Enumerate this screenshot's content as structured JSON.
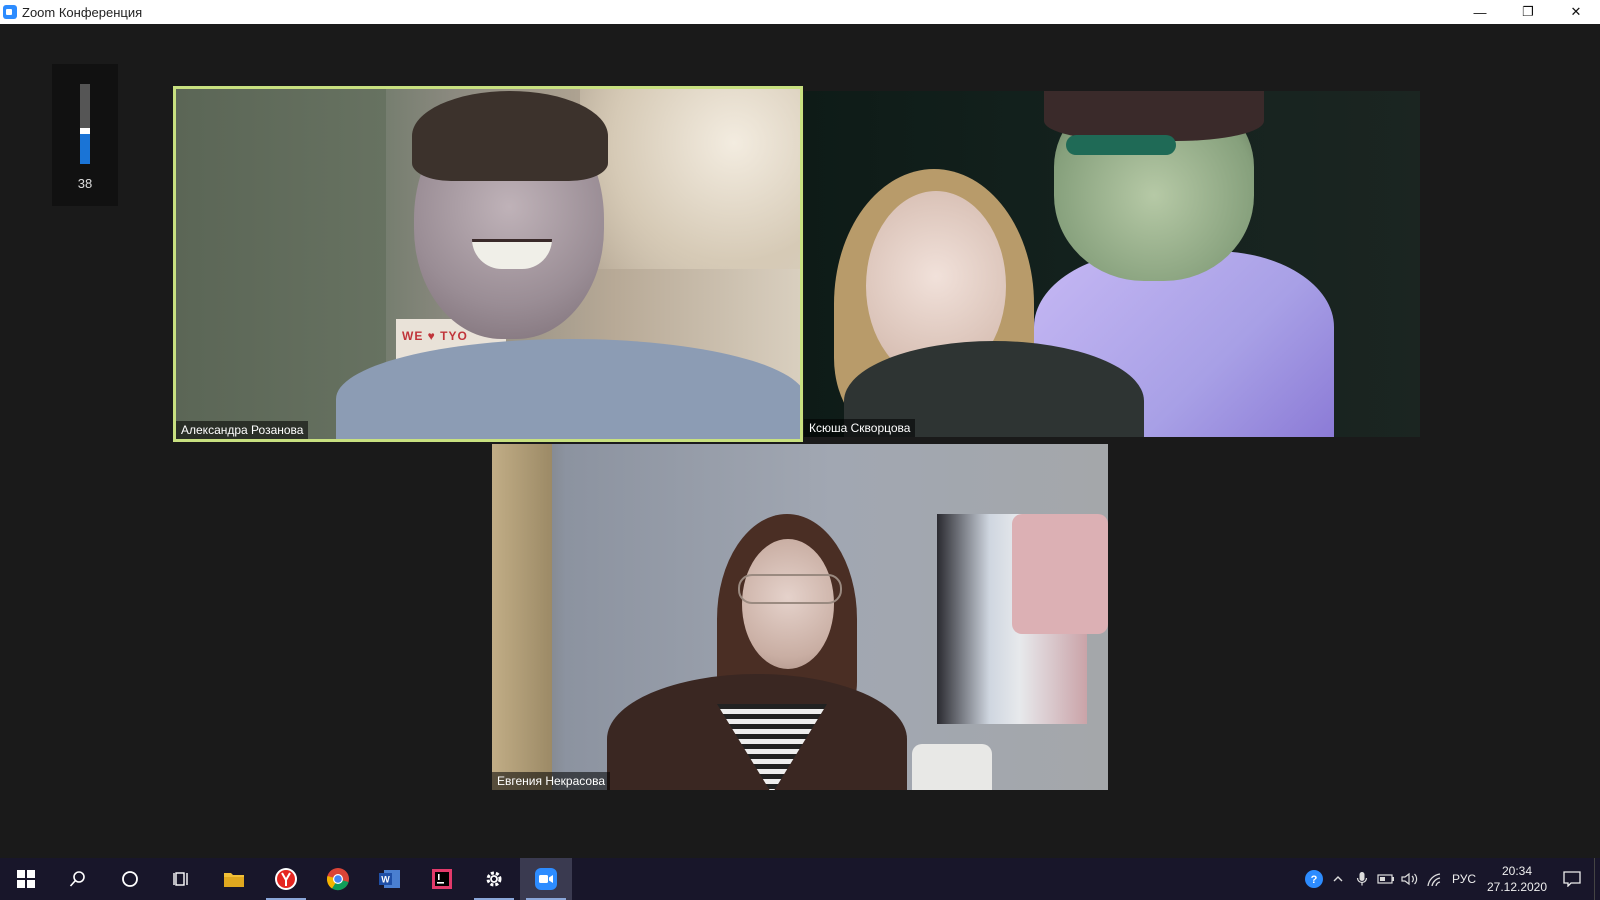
{
  "window": {
    "title": "Zoom Конференция",
    "controls": {
      "minimize": "—",
      "maximize": "❐",
      "close": "✕"
    }
  },
  "audio_meter": {
    "value": "38",
    "level": 0.38
  },
  "participants": [
    {
      "name": "Александра Розанова",
      "active_speaker": true
    },
    {
      "name": "Ксюша Скворцова",
      "active_speaker": false
    },
    {
      "name": "Евгения Некрасова",
      "active_speaker": false
    }
  ],
  "tile1_poster_text": "WE ♥ TYO",
  "taskbar": {
    "apps": [
      {
        "icon": "windows-start-icon"
      },
      {
        "icon": "search-icon"
      },
      {
        "icon": "cortana-icon"
      },
      {
        "icon": "task-view-icon"
      },
      {
        "icon": "file-explorer-icon"
      },
      {
        "icon": "yandex-browser-icon",
        "active": true
      },
      {
        "icon": "chrome-icon"
      },
      {
        "icon": "word-icon"
      },
      {
        "icon": "jetbrains-icon"
      },
      {
        "icon": "settings-icon",
        "active": true
      },
      {
        "icon": "zoom-icon",
        "active": true,
        "selected": true
      }
    ],
    "tray": {
      "language": "РУС",
      "time": "20:34",
      "date": "27.12.2020"
    }
  },
  "colors": {
    "active_speaker_border": "#c8e080",
    "meter_fill": "#1a74d6",
    "taskbar": "#18162a"
  }
}
